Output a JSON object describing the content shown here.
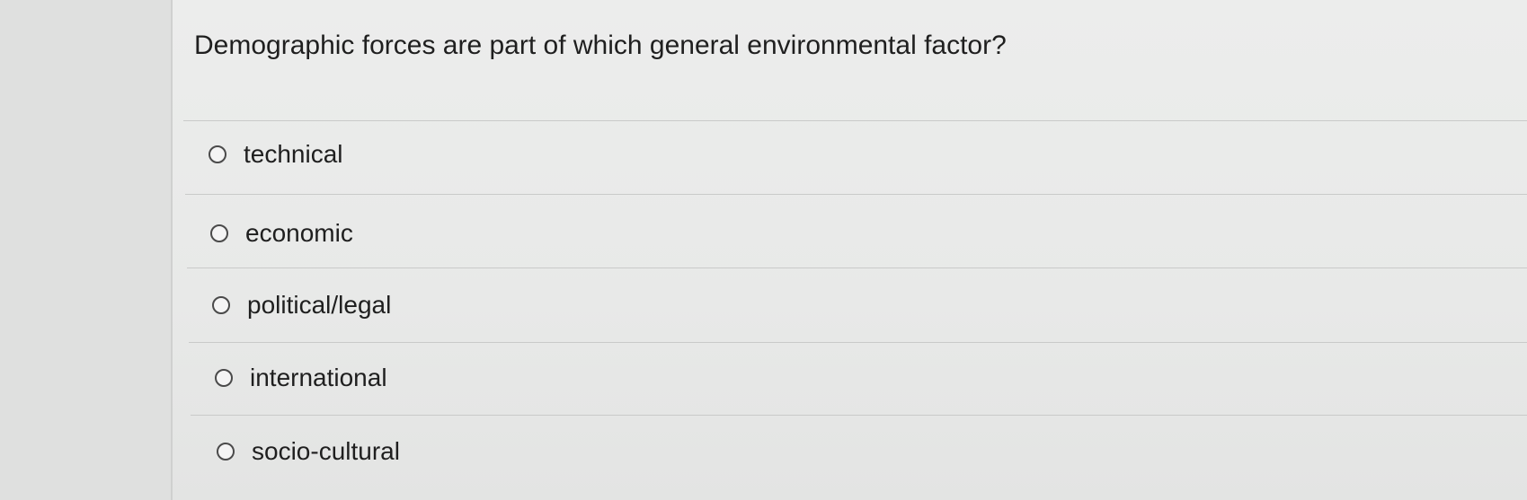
{
  "question": {
    "text": "Demographic forces are part of which general environmental factor?"
  },
  "options": [
    {
      "label": "technical",
      "selected": false
    },
    {
      "label": "economic",
      "selected": false
    },
    {
      "label": "political/legal",
      "selected": false
    },
    {
      "label": "international",
      "selected": false
    },
    {
      "label": "socio-cultural",
      "selected": false
    }
  ]
}
